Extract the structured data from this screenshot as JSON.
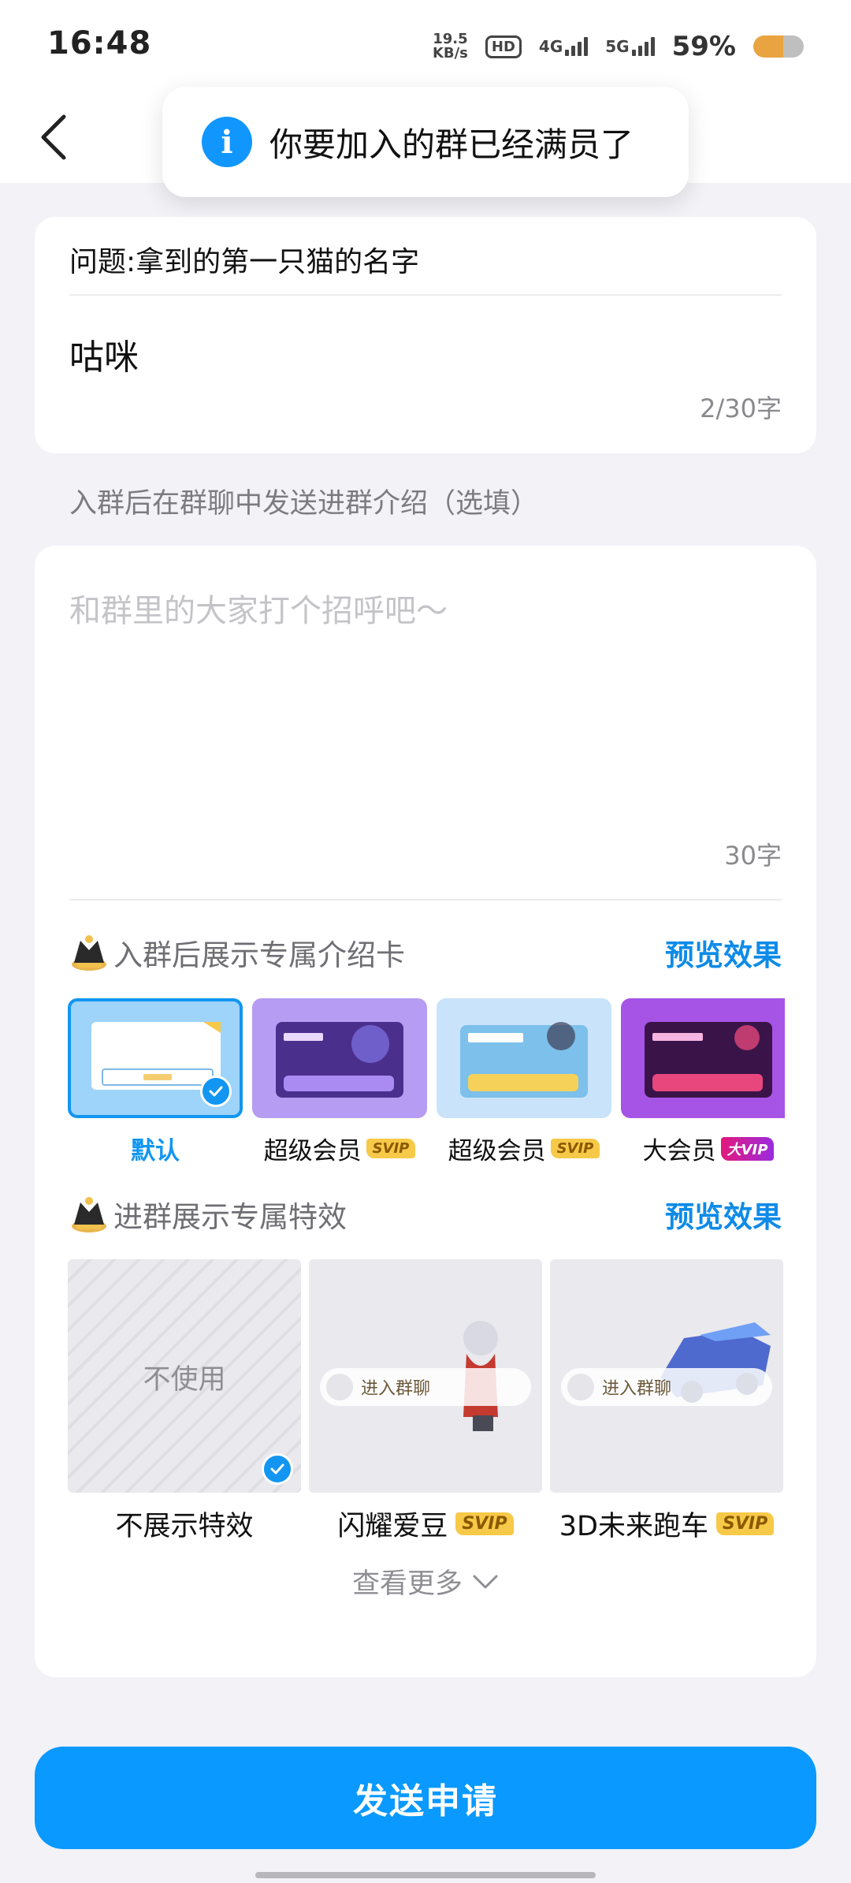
{
  "status_bar": {
    "time": "16:48",
    "net_speed_value": "19.5",
    "net_speed_unit": "KB/s",
    "hd_label": "HD",
    "signal_4g": "4G",
    "signal_5g": "5G",
    "battery_percent": "59%",
    "battery_level": 0.59
  },
  "toast": {
    "icon": "info-icon",
    "icon_glyph": "i",
    "message": "你要加入的群已经满员了"
  },
  "question": {
    "title": "问题:拿到的第一只猫的名字",
    "answer": "咕咪",
    "counter": "2/30字"
  },
  "intro": {
    "label": "入群后在群聊中发送进群介绍（选填）",
    "placeholder": "和群里的大家打个招呼吧～",
    "counter": "30字"
  },
  "intro_card_section": {
    "title": "入群后展示专属介绍卡",
    "preview_link": "预览效果",
    "cards": [
      {
        "label": "默认",
        "badge": "",
        "selected": true
      },
      {
        "label": "超级会员",
        "badge": "SVIP",
        "selected": false
      },
      {
        "label": "超级会员",
        "badge": "SVIP",
        "selected": false
      },
      {
        "label": "大会员",
        "badge": "大VIP",
        "selected": false
      }
    ]
  },
  "effects_section": {
    "title": "进群展示专属特效",
    "preview_link": "预览效果",
    "none_text": "不使用",
    "pill_text": "进入群聊",
    "effects": [
      {
        "label": "不展示特效",
        "badge": "",
        "selected": true
      },
      {
        "label": "闪耀爱豆",
        "badge": "SVIP",
        "selected": false
      },
      {
        "label": "3D未来跑车",
        "badge": "SVIP",
        "selected": false
      }
    ],
    "more": "查看更多"
  },
  "send_button": "发送申请",
  "colors": {
    "accent": "#0A99FF",
    "link": "#0E8BE8",
    "svip": "#F7C948"
  }
}
